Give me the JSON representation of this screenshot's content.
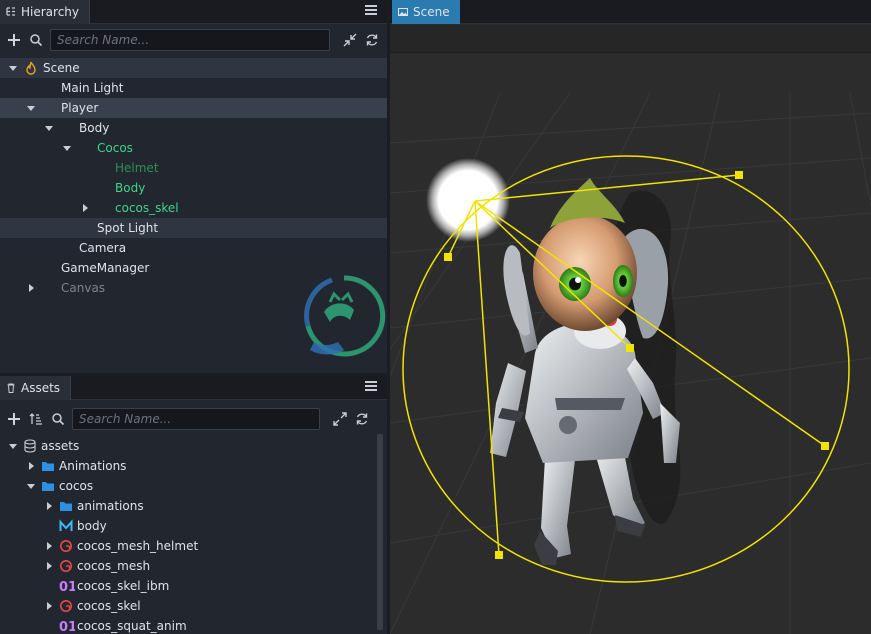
{
  "hierarchy": {
    "tab_label": "Hierarchy",
    "search_placeholder": "Search Name...",
    "nodes": [
      {
        "label": "Scene",
        "depth": 0,
        "arrow": "down",
        "color": "#dfe3ea",
        "icon": "scene-flame-icon",
        "state": "hover"
      },
      {
        "label": "Main Light",
        "depth": 1,
        "arrow": "",
        "color": "#dfe3ea",
        "state": ""
      },
      {
        "label": "Player",
        "depth": 1,
        "arrow": "down",
        "color": "#dfe3ea",
        "state": "selected"
      },
      {
        "label": "Body",
        "depth": 2,
        "arrow": "down",
        "color": "#dfe3ea",
        "state": ""
      },
      {
        "label": "Cocos",
        "depth": 3,
        "arrow": "down",
        "color": "#3dd68c",
        "state": ""
      },
      {
        "label": "Helmet",
        "depth": 4,
        "arrow": "",
        "color": "#2f8f5e",
        "state": ""
      },
      {
        "label": "Body",
        "depth": 4,
        "arrow": "",
        "color": "#3dd68c",
        "state": ""
      },
      {
        "label": "cocos_skel",
        "depth": 4,
        "arrow": "right",
        "color": "#3dd68c",
        "state": ""
      },
      {
        "label": "Spot Light",
        "depth": 3,
        "arrow": "",
        "color": "#dfe3ea",
        "state": "hover"
      },
      {
        "label": "Camera",
        "depth": 2,
        "arrow": "",
        "color": "#dfe3ea",
        "state": ""
      },
      {
        "label": "GameManager",
        "depth": 1,
        "arrow": "",
        "color": "#dfe3ea",
        "state": ""
      },
      {
        "label": "Canvas",
        "depth": 1,
        "arrow": "right",
        "color": "#7d838d",
        "state": ""
      }
    ]
  },
  "assets": {
    "tab_label": "Assets",
    "search_placeholder": "Search Name...",
    "nodes": [
      {
        "label": "assets",
        "depth": 0,
        "arrow": "down",
        "icon": "database-icon"
      },
      {
        "label": "Animations",
        "depth": 1,
        "arrow": "right",
        "icon": "folder-icon"
      },
      {
        "label": "cocos",
        "depth": 1,
        "arrow": "down",
        "icon": "folder-icon"
      },
      {
        "label": "animations",
        "depth": 2,
        "arrow": "right",
        "icon": "folder-icon"
      },
      {
        "label": "body",
        "depth": 2,
        "arrow": "",
        "icon": "mesh-m-icon"
      },
      {
        "label": "cocos_mesh_helmet",
        "depth": 2,
        "arrow": "right",
        "icon": "prefab-g-icon"
      },
      {
        "label": "cocos_mesh",
        "depth": 2,
        "arrow": "right",
        "icon": "prefab-g-icon"
      },
      {
        "label": "cocos_skel_ibm",
        "depth": 2,
        "arrow": "",
        "icon": "binary-01-icon"
      },
      {
        "label": "cocos_skel",
        "depth": 2,
        "arrow": "right",
        "icon": "prefab-g-icon"
      },
      {
        "label": "cocos_squat_anim",
        "depth": 2,
        "arrow": "",
        "icon": "binary-01-icon"
      }
    ]
  },
  "scene": {
    "tab_label": "Scene"
  },
  "colors": {
    "accent_tab": "#2a7bb0",
    "gizmo": "#f2e300",
    "selection": "#38404e"
  }
}
